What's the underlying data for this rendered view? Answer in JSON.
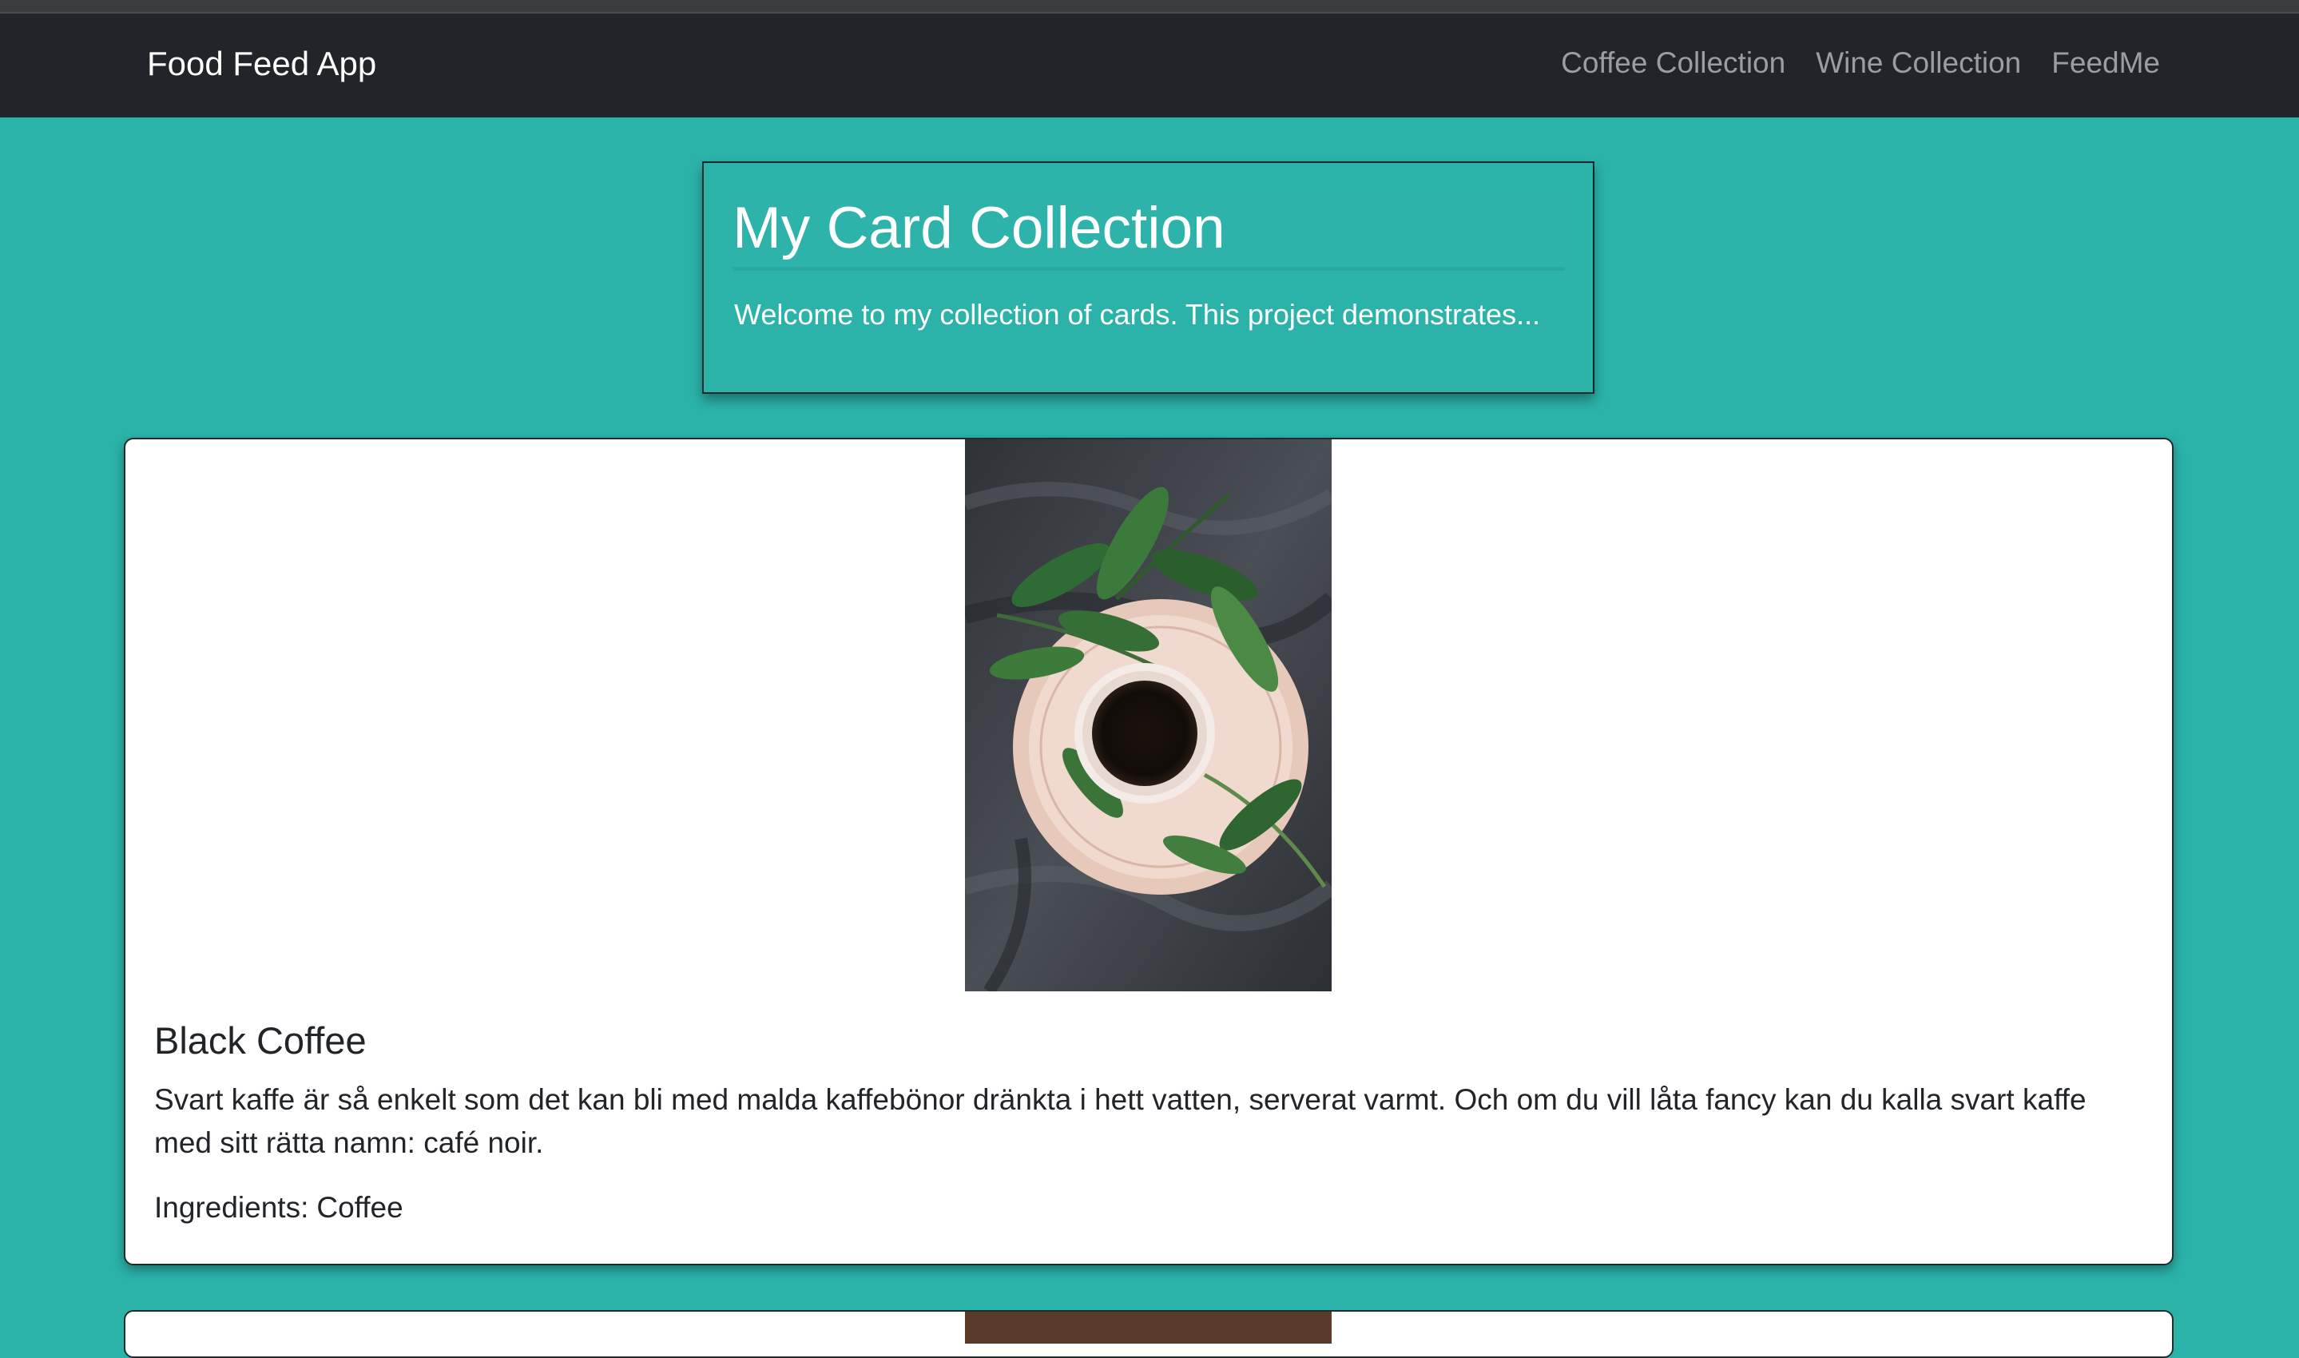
{
  "navbar": {
    "brand": "Food Feed App",
    "links": [
      "Coffee Collection",
      "Wine Collection",
      "FeedMe"
    ]
  },
  "header": {
    "title": "My Card Collection",
    "subtitle": "Welcome to my collection of cards. This project demonstrates..."
  },
  "cards": [
    {
      "image": "coffee-cup-on-tray-with-leaves",
      "title": "Black Coffee",
      "description": "Svart kaffe är så enkelt som det kan bli med malda kaffebönor dränkta i hett vatten, serverat varmt. Och om du vill låta fancy kan du kalla svart kaffe med sitt rätta namn: café noir.",
      "ingredients_label": "Ingredients:",
      "ingredients": "Coffee"
    }
  ],
  "colors": {
    "page_background": "#2bb3aa",
    "navbar_background": "#212529",
    "nav_link": "#9a9da1",
    "card_background": "#ffffff"
  }
}
